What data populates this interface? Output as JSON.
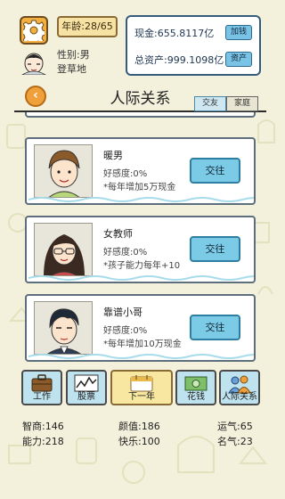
{
  "header": {
    "age": "年龄:28/65",
    "gender": "性别:男",
    "place": "登草地",
    "cash": "现金:655.8117亿",
    "add_money_label": "加钱",
    "assets": "总资产:999.1098亿",
    "assets_label": "资产"
  },
  "title": {
    "text": "人际关系",
    "tabs": [
      "交友",
      "家庭"
    ]
  },
  "people": [
    {
      "name": "暖男",
      "favor": "好感度:0%",
      "effect": "*每年增加5万现金",
      "action": "交往"
    },
    {
      "name": "女教师",
      "favor": "好感度:0%",
      "effect": "*孩子能力每年+10",
      "action": "交往"
    },
    {
      "name": "靠谱小哥",
      "favor": "好感度:0%",
      "effect": "*每年增加10万现金",
      "action": "交往"
    }
  ],
  "nav": {
    "work": "工作",
    "stock": "股票",
    "next_year": "下一年",
    "spend": "花钱",
    "social": "人际关系"
  },
  "stats": {
    "iq": "智商:146",
    "looks": "颜值:186",
    "luck": "运气:65",
    "ability": "能力:218",
    "happiness": "快乐:100",
    "fame": "名气:23"
  },
  "icons": {
    "settings": "gear-icon",
    "back": "back-arrow-icon",
    "work": "briefcase-icon",
    "stock": "stock-chart-icon",
    "next_year": "calendar-icon",
    "spend": "money-bill-icon",
    "social": "people-icon"
  },
  "colors": {
    "background": "#f3f1dc",
    "button_blue": "#7ccbe6",
    "gear_orange": "#f2b040",
    "next_year_yellow": "#f7e7a0"
  }
}
